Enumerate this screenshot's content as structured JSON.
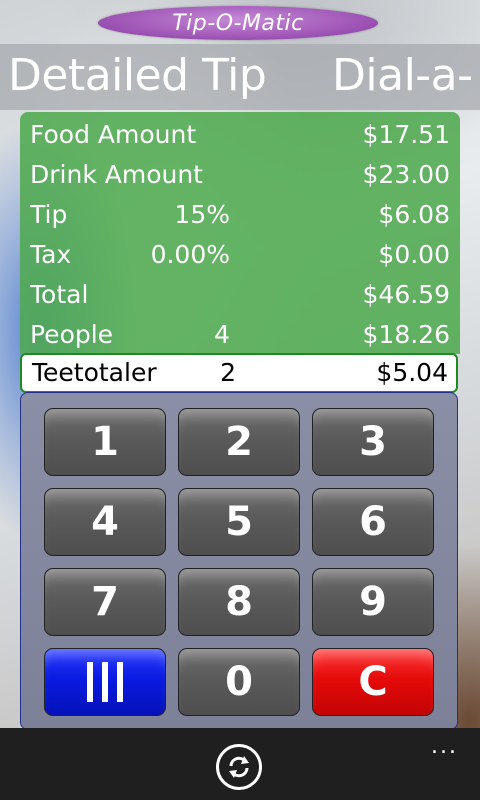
{
  "app": {
    "title": "Tip-O-Matic"
  },
  "pivot": {
    "active": "Detailed Tip",
    "next": "Dial-a-"
  },
  "rows": [
    {
      "label": "Food Amount",
      "middle": "",
      "amount": "$17.51"
    },
    {
      "label": "Drink Amount",
      "middle": "",
      "amount": "$23.00"
    },
    {
      "label": "Tip",
      "middle": "15%",
      "amount": "$6.08"
    },
    {
      "label": "Tax",
      "middle": "0.00%",
      "amount": "$0.00"
    },
    {
      "label": "Total",
      "middle": "",
      "amount": "$46.59"
    },
    {
      "label": "People",
      "middle": "4",
      "amount": "$18.26"
    }
  ],
  "teetotaler": {
    "label": "Teetotaler",
    "count": "2",
    "amount": "$5.04"
  },
  "keypad": {
    "keys": [
      "1",
      "2",
      "3",
      "4",
      "5",
      "6",
      "7",
      "8",
      "9",
      "",
      "0",
      "C"
    ],
    "special_icon": "split-bars-icon"
  },
  "app_bar": {
    "refresh_icon": "refresh-icon",
    "more_label": "..."
  },
  "colors": {
    "title_pill": "#9a4fb2",
    "panel_green": "#50aa50",
    "key_blue": "#0a1ae0",
    "key_red": "#e50a0a",
    "app_bar": "#1f1f1f"
  }
}
